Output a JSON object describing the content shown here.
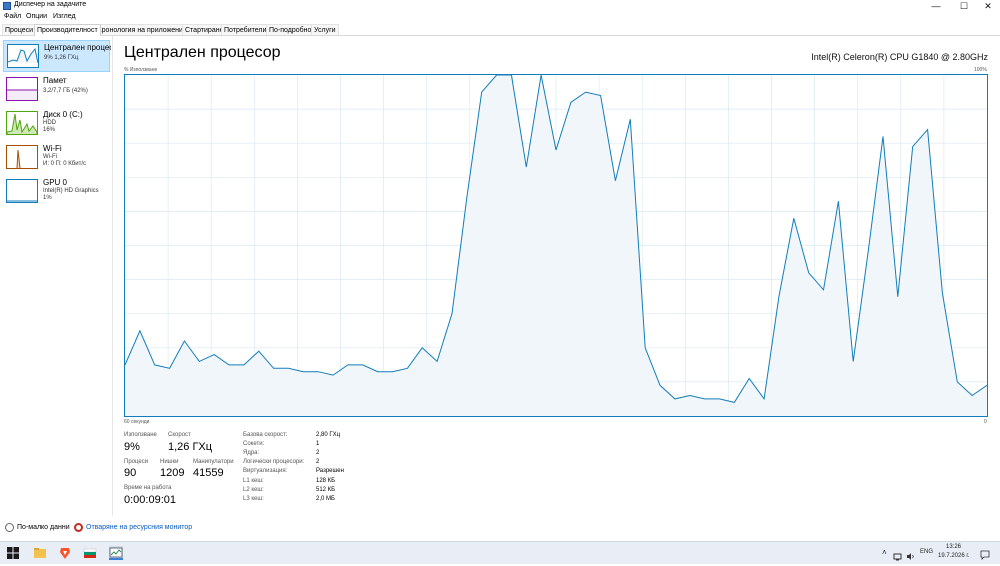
{
  "window": {
    "title": "Диспечер на задачите",
    "minimize": "—",
    "maximize": "☐",
    "close": "✕"
  },
  "menu": [
    "Файл",
    "Опции",
    "Изглед"
  ],
  "tabs": [
    "Процеси",
    "Производителност",
    "Хронология на приложение",
    "Стартиране",
    "Потребители",
    "По-подробно",
    "Услуги"
  ],
  "active_tab": 1,
  "sidebar": [
    {
      "title": "Централен процесор",
      "lines": [
        "9% 1,26 ГХц"
      ],
      "color": "#117dbb"
    },
    {
      "title": "Памет",
      "lines": [
        "3,2/7,7 ГБ (42%)"
      ],
      "color": "#8b12ae"
    },
    {
      "title": "Диск 0 (C:)",
      "lines": [
        "HDD",
        "16%"
      ],
      "color": "#4da60c"
    },
    {
      "title": "Wi-Fi",
      "lines": [
        "Wi-Fi",
        "И: 0 П: 0 Кбит/с"
      ],
      "color": "#a74f01"
    },
    {
      "title": "GPU 0",
      "lines": [
        "Intel(R) HD Graphics",
        "1%"
      ],
      "color": "#117dbb"
    }
  ],
  "main": {
    "title": "Централен процесор",
    "cpu_name": "Intel(R) Celeron(R) CPU G1840 @ 2.80GHz",
    "usage_label": "% Използване",
    "max_label": "100%",
    "time_label": "60 секунди",
    "min_label": "0"
  },
  "chart_data": {
    "type": "area",
    "ylim": [
      0,
      100
    ],
    "y": [
      15,
      25,
      15,
      14,
      22,
      16,
      18,
      15,
      15,
      19,
      14,
      14,
      13,
      13,
      12,
      15,
      15,
      13,
      13,
      14,
      20,
      16,
      30,
      64,
      95,
      100,
      100,
      73,
      100,
      78,
      92,
      95,
      94,
      69,
      87,
      20,
      9,
      5,
      6,
      5,
      5,
      4,
      11,
      5,
      35,
      58,
      42,
      37,
      63,
      16,
      48,
      82,
      35,
      79,
      84,
      36,
      10,
      6,
      9
    ],
    "color": "#117dbb",
    "fill": "#f1f6fa",
    "grid": true
  },
  "stats": {
    "usage_label": "Използване",
    "usage_value": "9%",
    "speed_label": "Скорост",
    "speed_value": "1,26 ГХц",
    "processes_label": "Процеси",
    "processes_value": "90",
    "threads_label": "Нишки",
    "threads_value": "1209",
    "handles_label": "Манипулатори",
    "handles_value": "41559",
    "uptime_label": "Време на работа",
    "uptime_value": "0:00:09:01"
  },
  "specs": [
    {
      "label": "Базова скорост:",
      "value": "2,80 ГХц"
    },
    {
      "label": "Сокети:",
      "value": "1"
    },
    {
      "label": "Ядра:",
      "value": "2"
    },
    {
      "label": "Логически процесори:",
      "value": "2"
    },
    {
      "label": "Виртуализация:",
      "value": "Разрешен"
    },
    {
      "label": "L1 кеш:",
      "value": "128 КБ"
    },
    {
      "label": "L2 кеш:",
      "value": "512 КБ"
    },
    {
      "label": "L3 кеш:",
      "value": "2,0 МБ"
    }
  ],
  "footer": {
    "fewer_details": "По-малко данни",
    "resource_monitor": "Отваряне на ресурсния монитор"
  },
  "taskbar": {
    "icons": [
      "windows-start-icon",
      "file-explorer-icon",
      "brave-browser-icon",
      "flag-app-icon",
      "task-manager-icon"
    ],
    "lang": "ENG",
    "time": "13:26",
    "date": "19.7.2026 г.",
    "tray": [
      "chevron-up-icon",
      "network-icon",
      "volume-icon",
      "notification-icon"
    ]
  }
}
